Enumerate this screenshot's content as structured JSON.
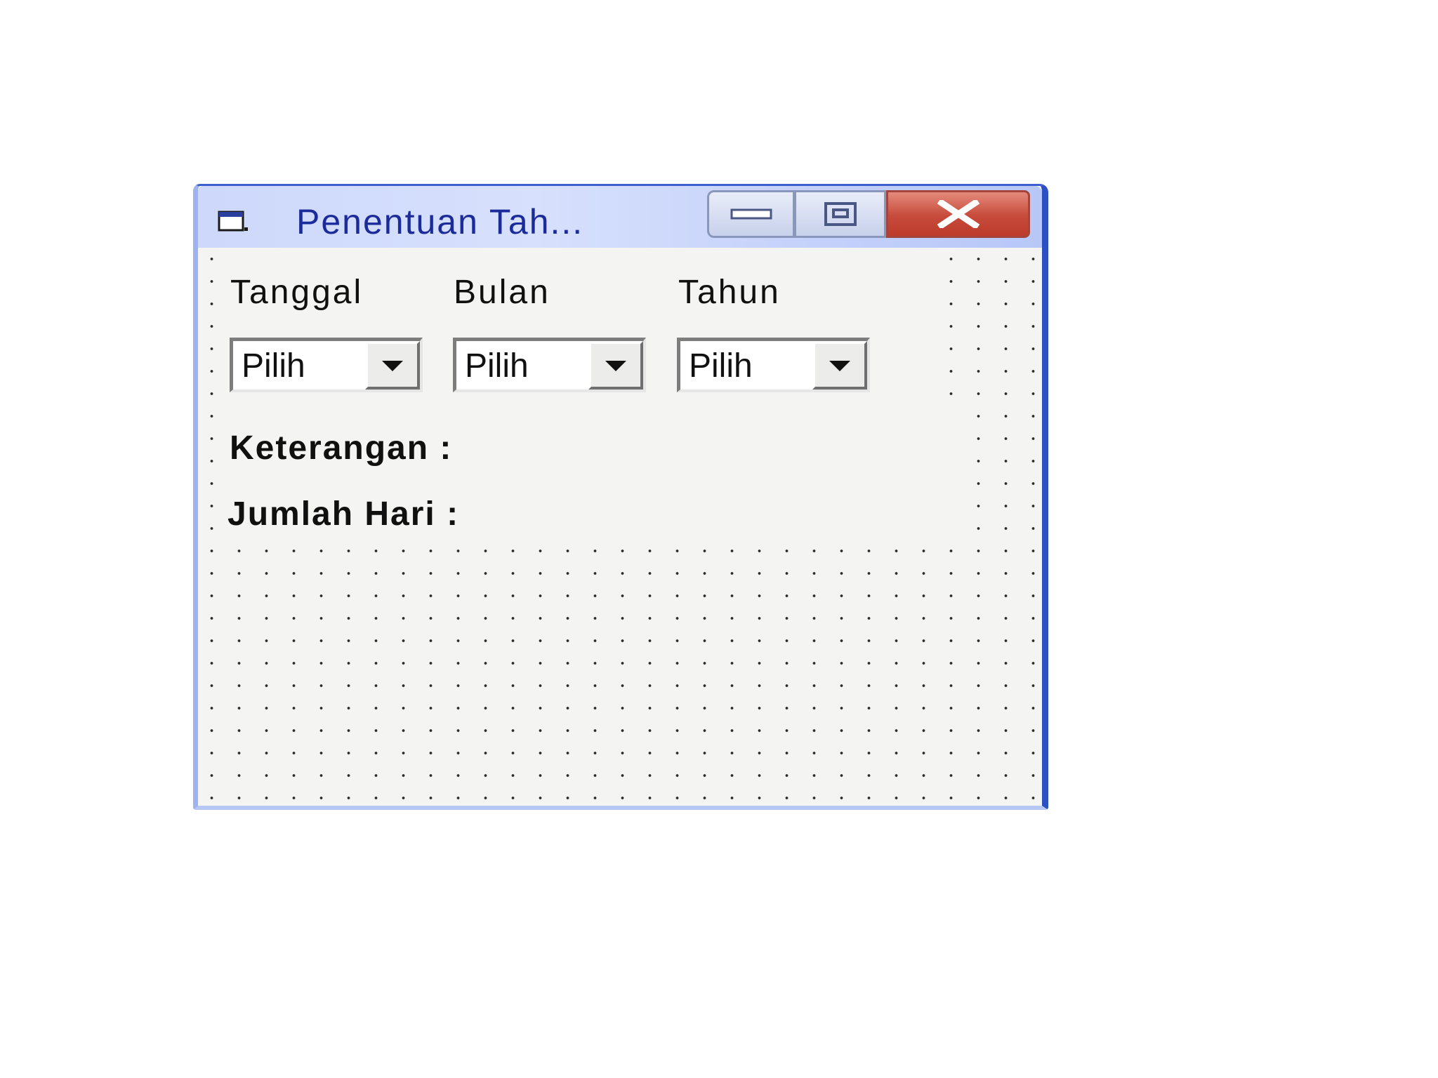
{
  "window": {
    "title": "Penentuan Tah...",
    "icon": "form-window-icon",
    "controls": {
      "minimize": "minimize-icon",
      "maximize": "maximize-icon",
      "close": "close-icon"
    }
  },
  "form": {
    "labels": {
      "tanggal": "Tanggal",
      "bulan": "Bulan",
      "tahun": "Tahun"
    },
    "combos": {
      "tanggal": "Pilih",
      "bulan": "Pilih",
      "tahun": "Pilih"
    },
    "keterangan_label": "Keterangan :",
    "jumlah_hari_label": "Jumlah Hari :"
  },
  "colors": {
    "titlebar": "#cdd8fb",
    "title_text": "#1b2c9a",
    "close_button": "#c74a3a",
    "form_background": "#f4f4f2"
  }
}
